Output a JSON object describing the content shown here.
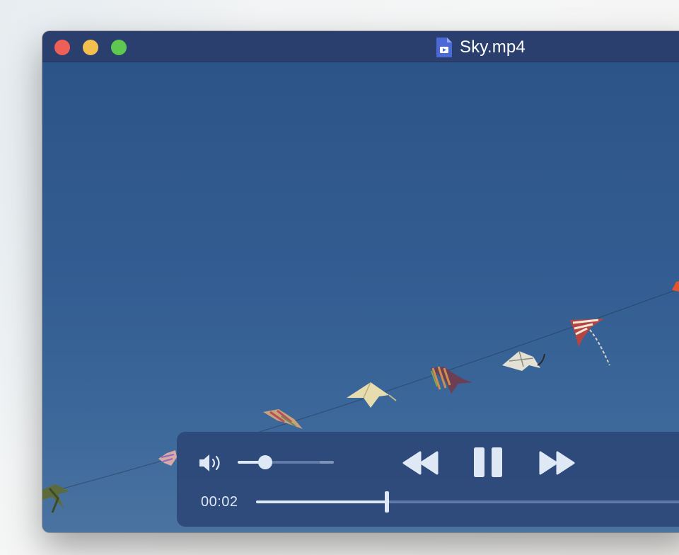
{
  "window": {
    "title": "Sky.mp4",
    "file_icon": "video-file-icon",
    "traffic_lights": {
      "close_color": "#ed5f57",
      "minimize_color": "#f4bf4f",
      "maximize_color": "#5fc850"
    }
  },
  "player": {
    "current_time": "00:02",
    "progress_fraction": 0.28,
    "volume_fraction": 0.29,
    "icons": {
      "volume": "speaker-icon",
      "rewind": "rewind-icon",
      "pause": "pause-icon",
      "fast_forward": "fast-forward-icon"
    },
    "accent_color": "#dfe8f5",
    "panel_color": "#2c4878"
  }
}
